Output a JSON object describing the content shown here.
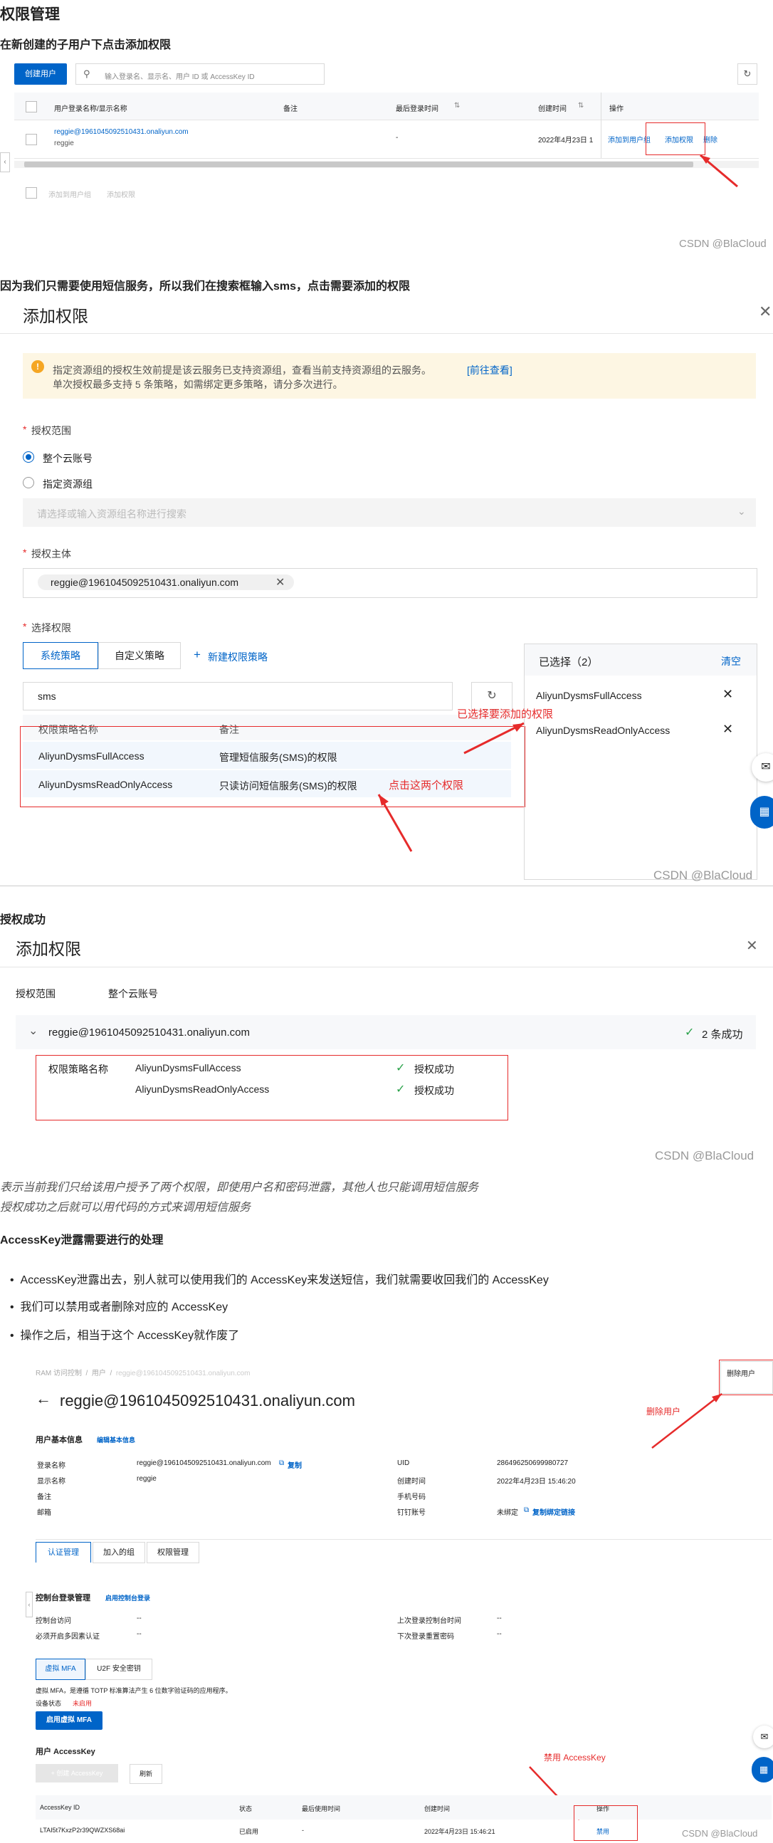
{
  "s1": {
    "heading": "权限管理",
    "subheading": "在新创建的子用户下点击添加权限",
    "create_button": "创建用户",
    "search_placeholder": "输入登录名、显示名、用户 ID 或 AccessKey ID",
    "columns": [
      "用户登录名称/显示名称",
      "备注",
      "最后登录时间",
      "创建时间",
      "操作"
    ],
    "user_login": "reggie@1961045092510431.onaliyun.com",
    "user_display": "reggie",
    "last_login": "-",
    "created": "2022年4月23日 1",
    "ops": [
      "添加到用户组",
      "添加权限",
      "删除"
    ],
    "footer_actions": [
      "添加到用户组",
      "添加权限"
    ],
    "watermark": "CSDN @BlaCloud"
  },
  "s2": {
    "heading": "因为我们只需要使用短信服务，所以我们在搜索框输入sms，点击需要添加的权限",
    "dialog_title": "添加权限",
    "notice_line1": "指定资源组的授权生效前提是该云服务已支持资源组，查看当前支持资源组的云服务。",
    "notice_link": "[前往查看]",
    "notice_line2": "单次授权最多支持 5 条策略，如需绑定更多策略，请分多次进行。",
    "scope_label": "授权范围",
    "scope_opt1": "整个云账号",
    "scope_opt2": "指定资源组",
    "rg_placeholder": "请选择或输入资源组名称进行搜索",
    "principal_label": "授权主体",
    "principal_tag": "reggie@1961045092510431.onaliyun.com",
    "perm_label": "选择权限",
    "tab_system": "系统策略",
    "tab_custom": "自定义策略",
    "new_policy": "新建权限策略",
    "search_value": "sms",
    "col_name": "权限策略名称",
    "col_note": "备注",
    "policies": [
      {
        "name": "AliyunDysmsFullAccess",
        "note": "管理短信服务(SMS)的权限"
      },
      {
        "name": "AliyunDysmsReadOnlyAccess",
        "note": "只读访问短信服务(SMS)的权限"
      }
    ],
    "selected_title": "已选择（2）",
    "clear": "清空",
    "selected": [
      "AliyunDysmsFullAccess",
      "AliyunDysmsReadOnlyAccess"
    ],
    "ann_selected": "已选择要添加的权限",
    "ann_click": "点击这两个权限",
    "watermark": "CSDN @BlaCloud"
  },
  "s3": {
    "heading": "授权成功",
    "dialog_title": "添加权限",
    "scope_label": "授权范围",
    "scope_value": "整个云账号",
    "principal": "reggie@1961045092510431.onaliyun.com",
    "success_count": "2 条成功",
    "policy_label": "权限策略名称",
    "results": [
      {
        "name": "AliyunDysmsFullAccess",
        "status": "授权成功"
      },
      {
        "name": "AliyunDysmsReadOnlyAccess",
        "status": "授权成功"
      }
    ],
    "watermark": "CSDN @BlaCloud"
  },
  "notes": {
    "italic1": "表示当前我们只给该用户授予了两个权限，即使用户名和密码泄露，其他人也只能调用短信服务",
    "italic2": "授权成功之后就可以用代码的方式来调用短信服务",
    "heading": "AccessKey泄露需要进行的处理",
    "bullets": [
      "AccessKey泄露出去，别人就可以使用我们的 AccessKey来发送短信，我们就需要收回我们的 AccessKey",
      "我们可以禁用或者删除对应的 AccessKey",
      "操作之后，相当于这个 AccessKey就作废了"
    ]
  },
  "s4": {
    "breadcrumb": [
      "RAM 访问控制",
      "用户",
      "reggie@1961045092510431.onaliyun.com"
    ],
    "delete_user": "删除用户",
    "title": "reggie@1961045092510431.onaliyun.com",
    "basic_info": "用户基本信息",
    "edit_basic": "编辑基本信息",
    "left_labels": [
      "登录名称",
      "显示名称",
      "备注",
      "邮箱"
    ],
    "login_value": "reggie@1961045092510431.onaliyun.com",
    "copy": "复制",
    "display_value": "reggie",
    "right_labels": [
      "UID",
      "创建时间",
      "手机号码",
      "钉钉账号"
    ],
    "uid": "286496250699980727",
    "created": "2022年4月23日 15:46:20",
    "dingtalk": "未绑定",
    "copy_bind_link": "复制绑定链接",
    "tabs": [
      "认证管理",
      "加入的组",
      "权限管理"
    ],
    "console_mgmt": "控制台登录管理",
    "enable_console": "启用控制台登录",
    "console_rows_left": [
      "控制台访问",
      "必须开启多因素认证"
    ],
    "console_rows_right": [
      "上次登录控制台时间",
      "下次登录重置密码"
    ],
    "dash": "--",
    "mfa_tabs": [
      "虚拟 MFA",
      "U2F 安全密钥"
    ],
    "mfa_desc": "虚拟 MFA，是遵循 TOTP 标准算法产生 6 位数字验证码的应用程序。",
    "device_status_label": "设备状态",
    "device_status": "未启用",
    "enable_mfa": "启用虚拟 MFA",
    "user_ak": "用户 AccessKey",
    "create_ak": "创建 AccessKey",
    "refresh": "刷新",
    "ak_columns": [
      "AccessKey ID",
      "状态",
      "最后使用时间",
      "创建时间",
      "操作"
    ],
    "ak_id": "LTAI5t7KxzP2r39QWZXS68ai",
    "ak_status": "已启用",
    "ak_last": "-",
    "ak_created": "2022年4月23日 15:46:21",
    "ak_op": "禁用",
    "ann_delete": "删除用户",
    "ann_disable": "禁用 AccessKey",
    "watermark": "CSDN @BlaCloud"
  }
}
